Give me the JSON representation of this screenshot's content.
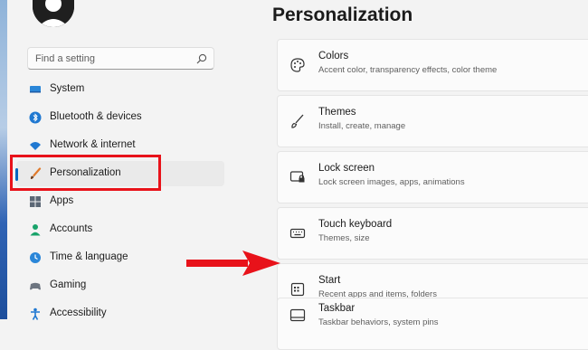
{
  "search": {
    "placeholder": "Find a setting"
  },
  "sidebar": {
    "items": [
      {
        "label": "System",
        "icon": "monitor-icon"
      },
      {
        "label": "Bluetooth & devices",
        "icon": "bluetooth-icon"
      },
      {
        "label": "Network & internet",
        "icon": "wifi-icon"
      },
      {
        "label": "Personalization",
        "icon": "brush-icon",
        "active": true
      },
      {
        "label": "Apps",
        "icon": "apps-icon"
      },
      {
        "label": "Accounts",
        "icon": "person-icon"
      },
      {
        "label": "Time & language",
        "icon": "globe-clock-icon"
      },
      {
        "label": "Gaming",
        "icon": "controller-icon"
      },
      {
        "label": "Accessibility",
        "icon": "accessibility-icon"
      }
    ]
  },
  "main": {
    "title": "Personalization",
    "cards": [
      {
        "title": "Colors",
        "subtitle": "Accent color, transparency effects, color theme",
        "icon": "palette-icon"
      },
      {
        "title": "Themes",
        "subtitle": "Install, create, manage",
        "icon": "brush-icon"
      },
      {
        "title": "Lock screen",
        "subtitle": "Lock screen images, apps, animations",
        "icon": "lock-screen-icon"
      },
      {
        "title": "Touch keyboard",
        "subtitle": "Themes, size",
        "icon": "keyboard-icon"
      },
      {
        "title": "Start",
        "subtitle": "Recent apps and items, folders",
        "icon": "start-icon"
      },
      {
        "title": "Taskbar",
        "subtitle": "Taskbar behaviors, system pins",
        "icon": "taskbar-icon"
      }
    ]
  },
  "colors": {
    "accent": "#0067c0",
    "annotation_red": "#e8121a",
    "window_bg": "#f3f3f3",
    "card_bg": "#fbfbfb"
  }
}
